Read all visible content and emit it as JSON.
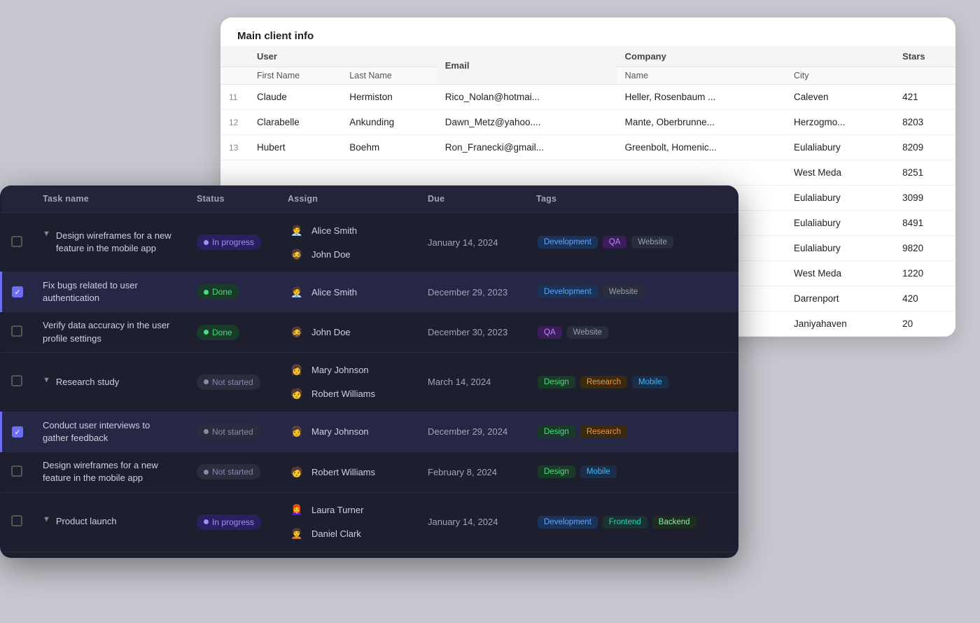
{
  "clientPanel": {
    "title": "Main client info",
    "columns": {
      "user": "User",
      "email": "Email",
      "company": "Company",
      "stars": "Stars",
      "firstName": "First Name",
      "lastName": "Last Name",
      "name": "Name",
      "city": "City"
    },
    "rows": [
      {
        "num": 11,
        "firstName": "Claude",
        "lastName": "Hermiston",
        "email": "Rico_Nolan@hotmai...",
        "companyName": "Heller, Rosenbaum ...",
        "city": "Caleven",
        "stars": 421
      },
      {
        "num": 12,
        "firstName": "Clarabelle",
        "lastName": "Ankunding",
        "email": "Dawn_Metz@yahoo....",
        "companyName": "Mante, Oberbrunne...",
        "city": "Herzogmo...",
        "stars": 8203
      },
      {
        "num": 13,
        "firstName": "Hubert",
        "lastName": "Boehm",
        "email": "Ron_Franecki@gmail...",
        "companyName": "Greenbolt, Homenic...",
        "city": "Eulaliabury",
        "stars": 8209
      },
      {
        "num": "",
        "firstName": "",
        "lastName": "",
        "email": "",
        "companyName": "",
        "city": "West Meda",
        "stars": 8251
      },
      {
        "num": "",
        "firstName": "",
        "lastName": "",
        "email": "",
        "companyName": "",
        "city": "Eulaliabury",
        "stars": 3099
      },
      {
        "num": "",
        "firstName": "",
        "lastName": "",
        "email": "",
        "companyName": "",
        "city": "Eulaliabury",
        "stars": 8491
      },
      {
        "num": "",
        "firstName": "",
        "lastName": "",
        "email": "",
        "companyName": "",
        "city": "Eulaliabury",
        "stars": 9820
      },
      {
        "num": "",
        "firstName": "",
        "lastName": "",
        "email": "",
        "companyName": "",
        "city": "West Meda",
        "stars": 1220
      },
      {
        "num": "",
        "firstName": "",
        "lastName": "",
        "email": "",
        "companyName": "",
        "city": "Darrenport",
        "stars": 420
      },
      {
        "num": "",
        "firstName": "",
        "lastName": "",
        "email": "",
        "companyName": "",
        "city": "Janiyahaven",
        "stars": 20
      }
    ]
  },
  "taskPanel": {
    "columns": {
      "taskName": "Task name",
      "status": "Status",
      "assign": "Assign",
      "due": "Due",
      "tags": "Tags"
    },
    "tasks": [
      {
        "id": 1,
        "checked": false,
        "expanded": true,
        "name": "Design wireframes for a new feature in the mobile app",
        "status": "inprogress",
        "statusLabel": "In progress",
        "due": "January 14, 2024",
        "assignees": [
          {
            "name": "Alice Smith",
            "emoji": "🧑‍💼"
          },
          {
            "name": "John Doe",
            "emoji": "🧔"
          }
        ],
        "tags": [
          {
            "label": "Development",
            "type": "development"
          },
          {
            "label": "QA",
            "type": "qa"
          },
          {
            "label": "Website",
            "type": "website"
          }
        ],
        "selected": false
      },
      {
        "id": 2,
        "checked": true,
        "expanded": false,
        "name": "Fix bugs related to user authentication",
        "status": "done",
        "statusLabel": "Done",
        "due": "December 29, 2023",
        "assignees": [
          {
            "name": "Alice Smith",
            "emoji": "🧑‍💼"
          }
        ],
        "tags": [
          {
            "label": "Development",
            "type": "development"
          },
          {
            "label": "Website",
            "type": "website"
          }
        ],
        "selected": true
      },
      {
        "id": 3,
        "checked": false,
        "expanded": false,
        "name": "Verify data accuracy in the user profile settings",
        "status": "done",
        "statusLabel": "Done",
        "due": "December 30, 2023",
        "assignees": [
          {
            "name": "John Doe",
            "emoji": "🧔"
          }
        ],
        "tags": [
          {
            "label": "QA",
            "type": "qa"
          },
          {
            "label": "Website",
            "type": "website"
          }
        ],
        "selected": false
      },
      {
        "id": 4,
        "checked": false,
        "expanded": true,
        "name": "Research study",
        "status": "notstarted",
        "statusLabel": "Not started",
        "due": "March 14, 2024",
        "assignees": [
          {
            "name": "Mary Johnson",
            "emoji": "👩"
          },
          {
            "name": "Robert Williams",
            "emoji": "🧑"
          }
        ],
        "tags": [
          {
            "label": "Design",
            "type": "design"
          },
          {
            "label": "Research",
            "type": "research"
          },
          {
            "label": "Mobile",
            "type": "mobile"
          }
        ],
        "selected": false
      },
      {
        "id": 5,
        "checked": true,
        "expanded": false,
        "name": "Conduct user interviews to gather feedback",
        "status": "notstarted",
        "statusLabel": "Not started",
        "due": "December 29, 2024",
        "assignees": [
          {
            "name": "Mary Johnson",
            "emoji": "👩"
          }
        ],
        "tags": [
          {
            "label": "Design",
            "type": "design"
          },
          {
            "label": "Research",
            "type": "research"
          }
        ],
        "selected": true
      },
      {
        "id": 6,
        "checked": false,
        "expanded": false,
        "name": "Design wireframes for a new feature in the mobile app",
        "status": "notstarted",
        "statusLabel": "Not started",
        "due": "February 8, 2024",
        "assignees": [
          {
            "name": "Robert Williams",
            "emoji": "🧑"
          }
        ],
        "tags": [
          {
            "label": "Design",
            "type": "design"
          },
          {
            "label": "Mobile",
            "type": "mobile"
          }
        ],
        "selected": false
      },
      {
        "id": 7,
        "checked": false,
        "expanded": true,
        "name": "Product launch",
        "status": "inprogress",
        "statusLabel": "In progress",
        "due": "January 14, 2024",
        "assignees": [
          {
            "name": "Laura Turner",
            "emoji": "👩‍🦰"
          },
          {
            "name": "Daniel Clark",
            "emoji": "🧑‍🦱"
          }
        ],
        "tags": [
          {
            "label": "Development",
            "type": "development"
          },
          {
            "label": "Frontend",
            "type": "frontend"
          },
          {
            "label": "Backend",
            "type": "backend"
          }
        ],
        "selected": false
      }
    ]
  }
}
